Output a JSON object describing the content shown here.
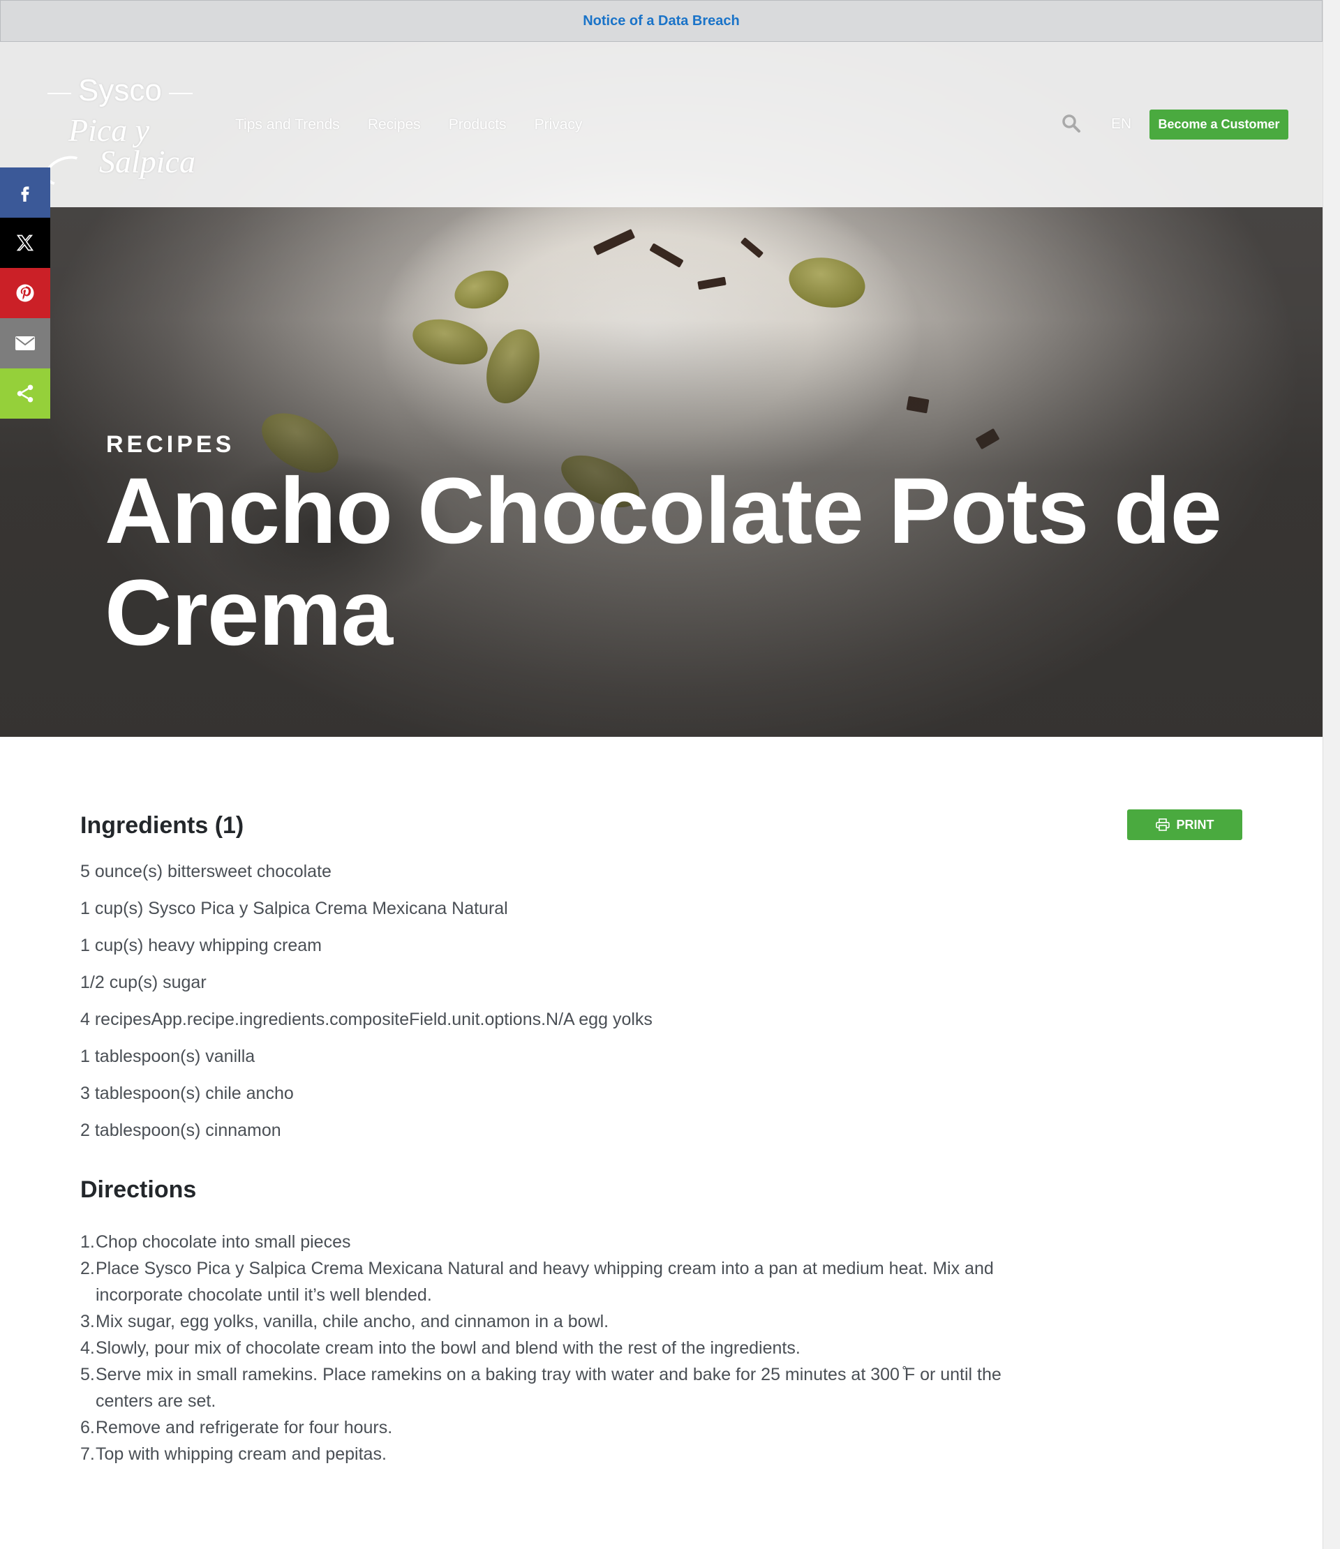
{
  "notice": {
    "link": "Notice of a Data Breach"
  },
  "logo": {
    "line1": "Sysco",
    "line2": "Pica y",
    "line3": "Salpica"
  },
  "nav": [
    "Tips and Trends",
    "Recipes",
    "Products",
    "Privacy"
  ],
  "header": {
    "lang": "EN",
    "cta": "Become a Customer"
  },
  "share": [
    "facebook-icon",
    "x-icon",
    "pinterest-icon",
    "email-icon",
    "share-icon"
  ],
  "hero": {
    "eyebrow": "RECIPES",
    "title": "Ancho Chocolate Pots de Crema"
  },
  "ingredients": {
    "title": "Ingredients (1)",
    "print": "PRINT",
    "items": [
      "5 ounce(s) bittersweet chocolate",
      "1 cup(s) Sysco Pica y Salpica Crema Mexicana Natural",
      "1 cup(s) heavy whipping cream",
      "1/2 cup(s) sugar",
      "4 recipesApp.recipe.ingredients.compositeField.unit.options.N/A egg yolks",
      "1 tablespoon(s) vanilla",
      "3 tablespoon(s) chile ancho",
      "2 tablespoon(s) cinnamon"
    ]
  },
  "directions": {
    "title": "Directions",
    "steps": [
      "Chop chocolate into small pieces",
      "Place Sysco Pica y Salpica Crema Mexicana Natural and heavy whipping cream into a pan at medium heat. Mix and incorporate chocolate until it’s well blended.",
      "Mix sugar, egg yolks, vanilla, chile ancho, and cinnamon in a bowl.",
      "Slowly, pour mix of chocolate cream into the bowl and blend with the rest of the ingredients.",
      "Serve mix in small ramekins. Place ramekins on a baking tray with water and bake for 25 minutes at 300 ̊F or until the centers are set.",
      "Remove and refrigerate for four hours.",
      "Top with whipping cream and pepitas."
    ]
  },
  "colors": {
    "accent_green": "#4aaa3f",
    "notice_link": "#1a73c8"
  }
}
